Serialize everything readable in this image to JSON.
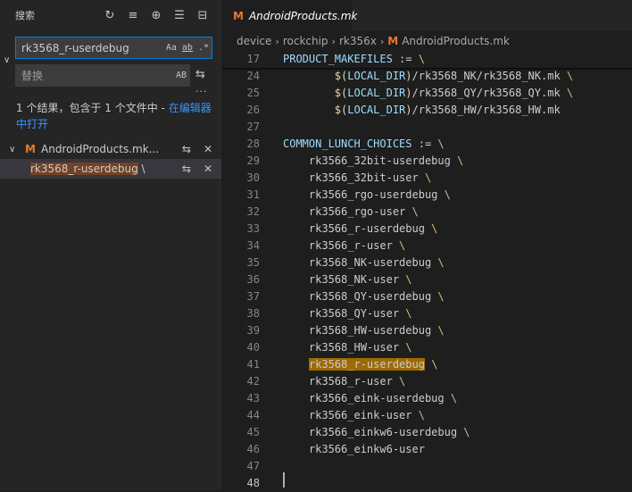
{
  "sidebar": {
    "title": "搜索",
    "search": {
      "value": "rk3568_r-userdebug",
      "opts": [
        "Aa",
        "ab",
        ".*"
      ]
    },
    "replace": {
      "placeholder": "替换",
      "opt": "AB"
    },
    "summary": {
      "text": "1 个结果，包含于 1 个文件中 - ",
      "link": "在编辑器中打开"
    },
    "file": {
      "name": "AndroidProducts.mk..."
    },
    "match": {
      "text_hl": "rk3568_r-userdebug",
      "text_rest": " \\"
    }
  },
  "tab": {
    "label": "AndroidProducts.mk",
    "icon": "M"
  },
  "breadcrumb": [
    "device",
    "rockchip",
    "rk356x",
    "AndroidProducts.mk"
  ],
  "editor": {
    "lines": [
      {
        "n": "17",
        "parts": [
          [
            "v",
            "PRODUCT_MAKEFILES"
          ],
          [
            "t",
            " := "
          ],
          [
            "bs",
            "\\"
          ]
        ]
      },
      {
        "n": "24",
        "parts": [
          [
            "t",
            "        "
          ],
          [
            "d",
            "$("
          ],
          [
            "v",
            "LOCAL_DIR"
          ],
          [
            "d",
            ")"
          ],
          [
            "t",
            "/rk3568_NK/rk3568_NK.mk "
          ],
          [
            "bs",
            "\\"
          ]
        ]
      },
      {
        "n": "25",
        "parts": [
          [
            "t",
            "        "
          ],
          [
            "d",
            "$("
          ],
          [
            "v",
            "LOCAL_DIR"
          ],
          [
            "d",
            ")"
          ],
          [
            "t",
            "/rk3568_QY/rk3568_QY.mk "
          ],
          [
            "bs",
            "\\"
          ]
        ]
      },
      {
        "n": "26",
        "parts": [
          [
            "t",
            "        "
          ],
          [
            "d",
            "$("
          ],
          [
            "v",
            "LOCAL_DIR"
          ],
          [
            "d",
            ")"
          ],
          [
            "t",
            "/rk3568_HW/rk3568_HW.mk"
          ]
        ]
      },
      {
        "n": "27",
        "parts": []
      },
      {
        "n": "28",
        "parts": [
          [
            "v",
            "COMMON_LUNCH_CHOICES"
          ],
          [
            "t",
            " := "
          ],
          [
            "bs",
            "\\"
          ]
        ]
      },
      {
        "n": "29",
        "parts": [
          [
            "t",
            "    rk3566_32bit-userdebug "
          ],
          [
            "bs",
            "\\"
          ]
        ]
      },
      {
        "n": "30",
        "parts": [
          [
            "t",
            "    rk3566_32bit-user "
          ],
          [
            "bs",
            "\\"
          ]
        ]
      },
      {
        "n": "31",
        "parts": [
          [
            "t",
            "    rk3566_rgo-userdebug "
          ],
          [
            "bs",
            "\\"
          ]
        ]
      },
      {
        "n": "32",
        "parts": [
          [
            "t",
            "    rk3566_rgo-user "
          ],
          [
            "bs",
            "\\"
          ]
        ]
      },
      {
        "n": "33",
        "parts": [
          [
            "t",
            "    rk3566_r-userdebug "
          ],
          [
            "bs",
            "\\"
          ]
        ]
      },
      {
        "n": "34",
        "parts": [
          [
            "t",
            "    rk3566_r-user "
          ],
          [
            "bs",
            "\\"
          ]
        ]
      },
      {
        "n": "35",
        "parts": [
          [
            "t",
            "    rk3568_NK-userdebug "
          ],
          [
            "bs",
            "\\"
          ]
        ]
      },
      {
        "n": "36",
        "parts": [
          [
            "t",
            "    rk3568_NK-user "
          ],
          [
            "bs",
            "\\"
          ]
        ]
      },
      {
        "n": "37",
        "parts": [
          [
            "t",
            "    rk3568_QY-userdebug "
          ],
          [
            "bs",
            "\\"
          ]
        ]
      },
      {
        "n": "38",
        "parts": [
          [
            "t",
            "    rk3568_QY-user "
          ],
          [
            "bs",
            "\\"
          ]
        ]
      },
      {
        "n": "39",
        "parts": [
          [
            "t",
            "    rk3568_HW-userdebug "
          ],
          [
            "bs",
            "\\"
          ]
        ]
      },
      {
        "n": "40",
        "parts": [
          [
            "t",
            "    rk3568_HW-user "
          ],
          [
            "bs",
            "\\"
          ]
        ]
      },
      {
        "n": "41",
        "parts": [
          [
            "t",
            "    "
          ],
          [
            "mh",
            "rk3568_r-userdebug"
          ],
          [
            "t",
            " "
          ],
          [
            "bs",
            "\\"
          ]
        ]
      },
      {
        "n": "42",
        "parts": [
          [
            "t",
            "    rk3568_r-user "
          ],
          [
            "bs",
            "\\"
          ]
        ]
      },
      {
        "n": "43",
        "parts": [
          [
            "t",
            "    rk3566_eink-userdebug "
          ],
          [
            "bs",
            "\\"
          ]
        ]
      },
      {
        "n": "44",
        "parts": [
          [
            "t",
            "    rk3566_eink-user "
          ],
          [
            "bs",
            "\\"
          ]
        ]
      },
      {
        "n": "45",
        "parts": [
          [
            "t",
            "    rk3566_einkw6-userdebug "
          ],
          [
            "bs",
            "\\"
          ]
        ]
      },
      {
        "n": "46",
        "parts": [
          [
            "t",
            "    rk3566_einkw6-user"
          ]
        ]
      },
      {
        "n": "47",
        "parts": []
      },
      {
        "n": "48",
        "parts": []
      }
    ]
  }
}
